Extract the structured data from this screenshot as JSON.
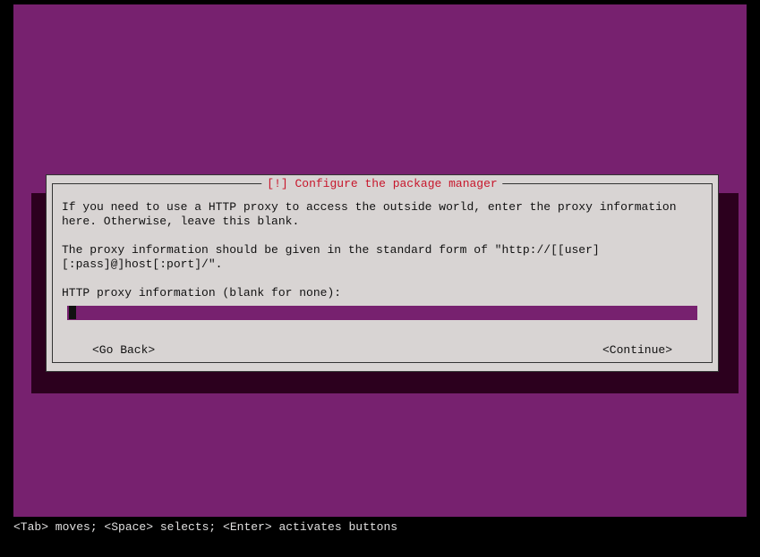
{
  "dialog": {
    "title": "[!] Configure the package manager",
    "para1": "If you need to use a HTTP proxy to access the outside world, enter the proxy information here. Otherwise, leave this blank.",
    "para2": "The proxy information should be given in the standard form of \"http://[[user][:pass]@]host[:port]/\".",
    "label": "HTTP proxy information (blank for none):",
    "input_value": "",
    "go_back": "<Go Back>",
    "continue": "<Continue>"
  },
  "hint": "<Tab> moves; <Space> selects; <Enter> activates buttons"
}
